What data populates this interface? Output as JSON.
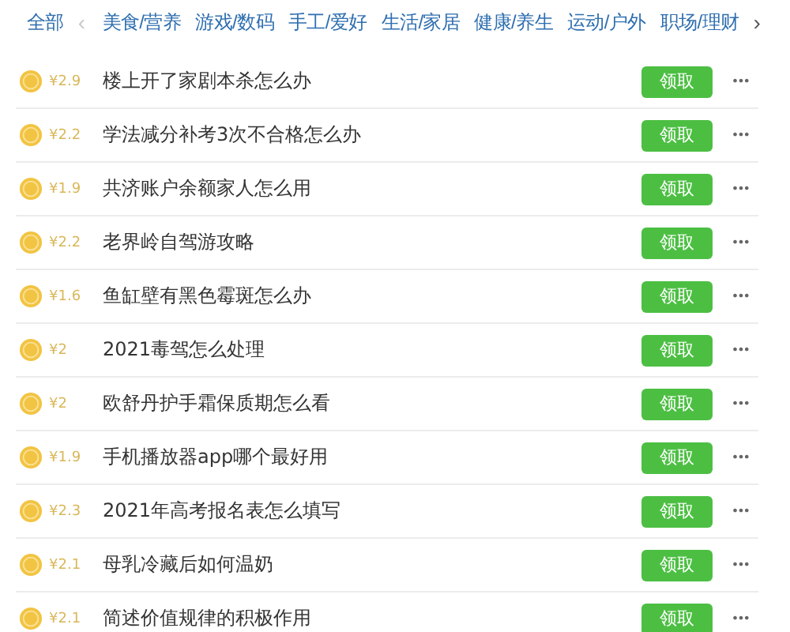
{
  "tabs": {
    "first": "全部",
    "prev": "‹",
    "items": [
      "美食/营养",
      "游戏/数码",
      "手工/爱好",
      "生活/家居",
      "健康/养生",
      "运动/户外",
      "职场/理财"
    ],
    "next": "›"
  },
  "tasks": [
    {
      "price": "¥2.9",
      "title": "楼上开了家剧本杀怎么办",
      "action": "领取",
      "more": "•••"
    },
    {
      "price": "¥2.2",
      "title": "学法减分补考3次不合格怎么办",
      "action": "领取",
      "more": "•••"
    },
    {
      "price": "¥1.9",
      "title": "共济账户余额家人怎么用",
      "action": "领取",
      "more": "•••"
    },
    {
      "price": "¥2.2",
      "title": "老界岭自驾游攻略",
      "action": "领取",
      "more": "•••"
    },
    {
      "price": "¥1.6",
      "title": "鱼缸壁有黑色霉斑怎么办",
      "action": "领取",
      "more": "•••"
    },
    {
      "price": "¥2",
      "title": "2021毒驾怎么处理",
      "action": "领取",
      "more": "•••"
    },
    {
      "price": "¥2",
      "title": "欧舒丹护手霜保质期怎么看",
      "action": "领取",
      "more": "•••"
    },
    {
      "price": "¥1.9",
      "title": "手机播放器app哪个最好用",
      "action": "领取",
      "more": "•••"
    },
    {
      "price": "¥2.3",
      "title": "2021年高考报名表怎么填写",
      "action": "领取",
      "more": "•••"
    },
    {
      "price": "¥2.1",
      "title": "母乳冷藏后如何温奶",
      "action": "领取",
      "more": "•••"
    },
    {
      "price": "¥2.1",
      "title": "简述价值规律的积极作用",
      "action": "领取",
      "more": "•••"
    }
  ]
}
